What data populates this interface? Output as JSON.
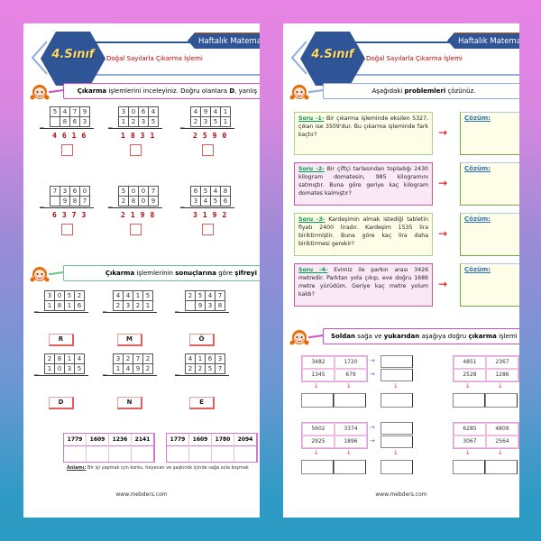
{
  "header": {
    "grade_badge": "4.Sınıf",
    "tab_label": "Haftalık Matematik",
    "subtitle": "Doğal Sayılarla Çıkarma İşlemi"
  },
  "left_page": {
    "instruction1": {
      "bold_lead": "Çıkarma",
      "rest": " işlemlerini inceleyiniz. Doğru olanlara ",
      "bold_d": "D",
      "tail": ", yanlış"
    },
    "check_problems": [
      {
        "top": [
          "5",
          "4",
          "7",
          "9"
        ],
        "bottom": [
          "",
          "8",
          "6",
          "3"
        ],
        "answer": [
          "4",
          "6",
          "1",
          "6"
        ]
      },
      {
        "top": [
          "3",
          "0",
          "6",
          "4"
        ],
        "bottom": [
          "1",
          "2",
          "3",
          "5"
        ],
        "answer": [
          "1",
          "8",
          "3",
          "1"
        ]
      },
      {
        "top": [
          "4",
          "9",
          "4",
          "1"
        ],
        "bottom": [
          "2",
          "3",
          "5",
          "1"
        ],
        "answer": [
          "2",
          "5",
          "9",
          "0"
        ]
      },
      {
        "top": [
          "7",
          "3",
          "6",
          "0"
        ],
        "bottom": [
          "",
          "9",
          "8",
          "7"
        ],
        "answer": [
          "6",
          "3",
          "7",
          "3"
        ]
      },
      {
        "top": [
          "5",
          "0",
          "0",
          "7"
        ],
        "bottom": [
          "2",
          "8",
          "0",
          "9"
        ],
        "answer": [
          "2",
          "1",
          "9",
          "8"
        ]
      },
      {
        "top": [
          "6",
          "5",
          "4",
          "8"
        ],
        "bottom": [
          "3",
          "4",
          "5",
          "6"
        ],
        "answer": [
          "3",
          "1",
          "9",
          "2"
        ]
      }
    ],
    "instruction2": {
      "bold_lead": "Çıkarma",
      "mid": " işlemlerinin ",
      "bold_mid": "sonuçlarına",
      "rest": " göre ",
      "bold_tail": "şifreyi"
    },
    "cipher_problems": [
      {
        "top": [
          "3",
          "0",
          "5",
          "2"
        ],
        "bottom": [
          "1",
          "8",
          "1",
          "6"
        ],
        "letter": "R"
      },
      {
        "top": [
          "4",
          "4",
          "1",
          "5"
        ],
        "bottom": [
          "2",
          "3",
          "2",
          "1"
        ],
        "letter": "M"
      },
      {
        "top": [
          "2",
          "5",
          "4",
          "7"
        ],
        "bottom": [
          "",
          "9",
          "3",
          "8"
        ],
        "letter": "Ö"
      },
      {
        "top": [
          "2",
          "8",
          "1",
          "4"
        ],
        "bottom": [
          "1",
          "0",
          "3",
          "5"
        ],
        "letter": "D"
      },
      {
        "top": [
          "3",
          "2",
          "7",
          "2"
        ],
        "bottom": [
          "1",
          "4",
          "9",
          "2"
        ],
        "letter": "N"
      },
      {
        "top": [
          "4",
          "1",
          "6",
          "3"
        ],
        "bottom": [
          "2",
          "2",
          "5",
          "7"
        ],
        "letter": "E"
      }
    ],
    "cipher_table_1": [
      "1779",
      "1609",
      "1236",
      "2141"
    ],
    "cipher_table_2": [
      "1779",
      "1609",
      "1780",
      "2094"
    ],
    "meaning_label": "Anlamı:",
    "meaning_text": " Bir işi yapmak için korku, heyecan ve şaşkınlık içinde sağa sola koşmak",
    "footer": "www.mebders.com"
  },
  "right_page": {
    "instruction": {
      "pre": "Aşağıdaki ",
      "bold": "problemleri",
      "post": " çözünüz."
    },
    "problems": [
      {
        "label": "Soru -1-",
        "text": " Bir çıkarma işleminde eksilen 5327, çıkan ise 3509'dur. Bu çıkarma işleminde fark kaçtır?",
        "theme": "y"
      },
      {
        "label": "Soru -2-",
        "text": " Bir çiftçi tarlasından topladığı 2430 kilogram domatesin, 985 kilogramını satmıştır. Buna göre geriye kaç kilogram domates kalmıştır?",
        "theme": "p"
      },
      {
        "label": "Soru -3-",
        "text": " Kardeşimin almak istediği tabletin fiyatı 2400 liradır. Kardeşim 1535 lira biriktirmiştir. Buna göre kaç lira daha biriktirmesi gerekir?",
        "theme": "y"
      },
      {
        "label": "Soru -4-",
        "text": " Evimiz ile parkın arası 3426 metredir. Parktan yola çıkıp, eve doğru 1689 metre yürüdüm. Geriye kaç metre yolum kaldı?",
        "theme": "p"
      }
    ],
    "solution_label": "Çözüm:",
    "arrow_glyph": "→",
    "instruction2": {
      "bold1": "Soldan",
      "t1": " sağa ve ",
      "bold2": "yukarıdan",
      "t2": " aşağıya doğru ",
      "bold3": "çıkarma",
      "t3": " işlemi"
    },
    "grids": [
      {
        "values": [
          "3482",
          "1720",
          "1345",
          "679"
        ]
      },
      {
        "values": [
          "4851",
          "2367",
          "2528",
          "1286"
        ]
      },
      {
        "values": [
          "5602",
          "3374",
          "2925",
          "1896"
        ]
      },
      {
        "values": [
          "6285",
          "4809",
          "3067",
          "2564"
        ]
      }
    ],
    "footer": "www.mebders.com"
  }
}
